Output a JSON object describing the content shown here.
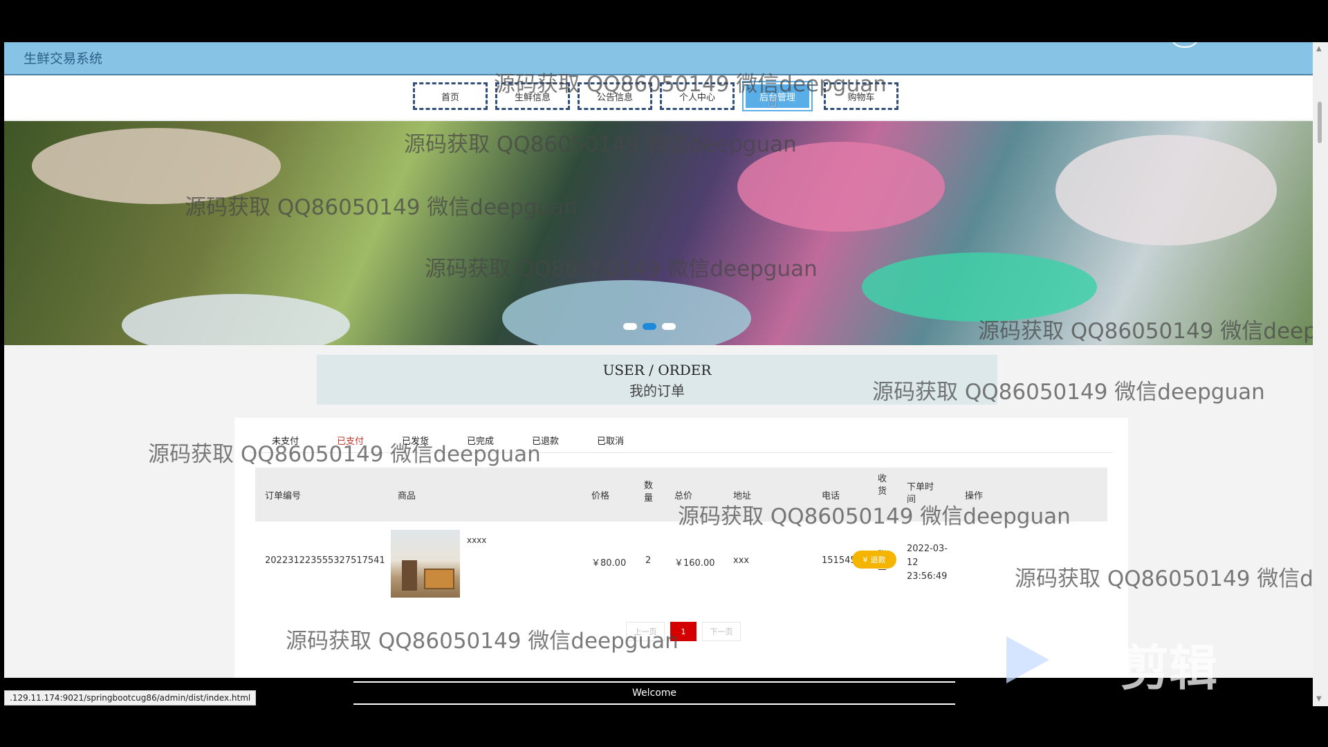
{
  "site": {
    "title": "生鲜交易系统"
  },
  "nav": {
    "items": [
      {
        "label": "首页"
      },
      {
        "label": "生鲜信息"
      },
      {
        "label": "公告信息"
      },
      {
        "label": "个人中心"
      },
      {
        "label": "后台管理",
        "active": true
      },
      {
        "label": "购物车"
      }
    ]
  },
  "banner": {
    "slides": 3,
    "current_slide": 2
  },
  "section": {
    "title_en": "USER / ORDER",
    "title_cn": "我的订单"
  },
  "status_tabs": [
    "未支付",
    "已支付",
    "已发货",
    "已完成",
    "已退款",
    "已取消"
  ],
  "active_status_tab": "已支付",
  "table": {
    "headers": [
      "订单编号",
      "商品",
      "价格",
      "数量",
      "总价",
      "地址",
      "电话",
      "收货",
      "下单时间",
      "操作"
    ],
    "rows": [
      {
        "order_no": "202231223555327517541",
        "product_name": "xxxx",
        "price": "￥80.00",
        "quantity": "2",
        "total": "￥160.00",
        "address": "xxx",
        "phone": "15154541454",
        "receiver": "张三",
        "order_time": "2022-03-12 23:56:49",
        "action": "退款"
      }
    ]
  },
  "pagination": {
    "prev": "上一页",
    "current": "1",
    "next": "下一页"
  },
  "watermark": "源码获取 QQ86050149 微信deepguan",
  "status_url": ".129.11.174:9021/springbootcug86/admin/dist/index.html",
  "footer": {
    "welcome": "Welcome"
  },
  "editor_badge": "剪辑",
  "colors": {
    "topbar": "#87c3e4",
    "active_nav": "#5aaee8",
    "active_tab": "#c0392b",
    "refund": "#f5b400",
    "page_current": "#d40000"
  },
  "icons": [
    "pointer-cursor-icon",
    "refund-coin-icon",
    "scroll-up-icon",
    "scroll-down-icon"
  ]
}
